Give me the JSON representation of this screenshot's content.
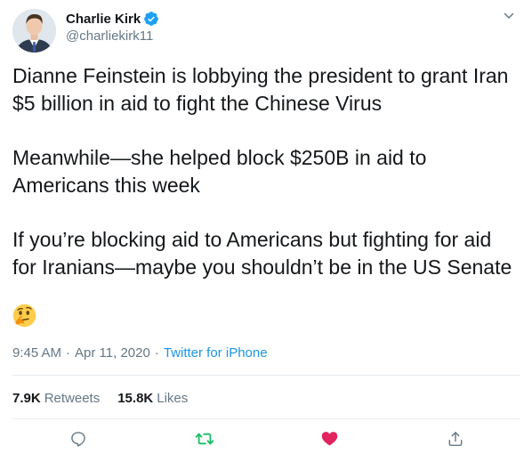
{
  "user": {
    "display_name": "Charlie Kirk",
    "handle": "@charliekirk11",
    "verified": true
  },
  "tweet": {
    "paragraphs": [
      "Dianne Feinstein is lobbying the president to grant Iran $5 billion in aid to fight the Chinese Virus",
      "Meanwhile—she helped block $250B in aid to Americans this week",
      "If you’re blocking aid to Americans but fighting for aid for Iranians—maybe you shouldn’t be in the US Senate"
    ],
    "emoji": "thinking-face",
    "time": "9:45 AM",
    "separator": "·",
    "date": "Apr 11, 2020",
    "source": "Twitter for iPhone"
  },
  "stats": {
    "retweets_count": "7.9K",
    "retweets_label": "Retweets",
    "likes_count": "15.8K",
    "likes_label": "Likes"
  },
  "actions": [
    {
      "name": "reply",
      "icon": "reply-icon"
    },
    {
      "name": "retweet",
      "icon": "retweet-icon"
    },
    {
      "name": "like",
      "icon": "heart-icon"
    },
    {
      "name": "share",
      "icon": "share-icon"
    }
  ],
  "colors": {
    "text": "#14171a",
    "secondary": "#657786",
    "link": "#1b95e0",
    "verified": "#1da1f2",
    "retweet": "#17bf63",
    "like": "#e0245e",
    "divider": "#e6ecf0"
  }
}
